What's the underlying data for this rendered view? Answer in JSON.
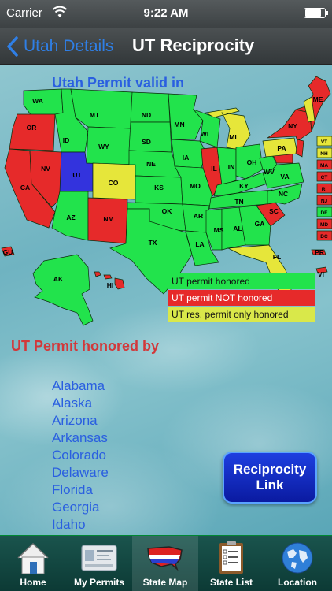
{
  "status_bar": {
    "carrier": "Carrier",
    "time": "9:22 AM",
    "battery_level": 0.85
  },
  "nav": {
    "back_label": "Utah Details",
    "title": "UT Reciprocity"
  },
  "map": {
    "heading": "Utah Permit valid in",
    "state_labels": [
      "WA",
      "OR",
      "CA",
      "ID",
      "NV",
      "UT",
      "AZ",
      "MT",
      "WY",
      "CO",
      "NM",
      "ND",
      "SD",
      "NE",
      "KS",
      "OK",
      "TX",
      "MN",
      "IA",
      "MO",
      "AR",
      "LA",
      "WI",
      "IL",
      "MI",
      "IN",
      "OH",
      "KY",
      "TN",
      "MS",
      "AL",
      "GA",
      "FL",
      "SC",
      "NC",
      "VA",
      "WV",
      "PA",
      "NY",
      "ME",
      "AK",
      "HI",
      "GU",
      "PR",
      "VI",
      "VT",
      "NH",
      "MA",
      "CT",
      "RI",
      "NJ",
      "DE",
      "MD",
      "DC"
    ],
    "colors": {
      "honored": "#22e34c",
      "not_honored": "#e62a2a",
      "resident_only": "#e6e63a",
      "home": "#3333dd"
    }
  },
  "legend": {
    "honored": "UT permit honored",
    "not_honored": "UT permit NOT honored",
    "resident_only": "UT res. permit only honored"
  },
  "honored_by": {
    "heading": "UT Permit honored by",
    "states": [
      "Alabama",
      "Alaska",
      "Arizona",
      "Arkansas",
      "Colorado",
      "Delaware",
      "Florida",
      "Georgia",
      "Idaho"
    ]
  },
  "reciprocity_button": {
    "line1": "Reciprocity",
    "line2": "Link"
  },
  "tabs": [
    {
      "label": "Home",
      "icon": "home-icon"
    },
    {
      "label": "My Permits",
      "icon": "permit-card-icon"
    },
    {
      "label": "State Map",
      "icon": "us-map-icon",
      "active": true
    },
    {
      "label": "State List",
      "icon": "clipboard-list-icon"
    },
    {
      "label": "Location",
      "icon": "globe-icon"
    }
  ]
}
